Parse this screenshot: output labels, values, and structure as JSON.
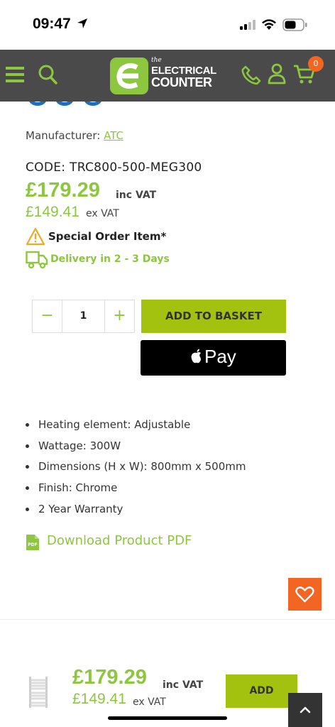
{
  "status_bar": {
    "time": "09:47"
  },
  "header": {
    "logo_the": "the",
    "logo_line1": "ELECTRICAL",
    "logo_line2": "COUNTER",
    "cart_count": "0",
    "brand_color": "#8dc63f",
    "header_bg": "#4a4a4a"
  },
  "product": {
    "manufacturer_label": "Manufacturer:",
    "manufacturer_value": "ATC",
    "code_label": "CODE:",
    "code_value": "TRC800-500-MEG300",
    "price_inc": "£179.29",
    "price_inc_label": "inc VAT",
    "price_ex": "£149.41",
    "price_ex_label": "ex VAT",
    "special_order": "Special Order Item*",
    "delivery": "Delivery in 2 - 3 Days",
    "quantity": "1",
    "quantity_minus": "−",
    "quantity_plus": "+",
    "add_to_basket": "ADD TO BASKET",
    "apple_pay": "Pay",
    "specs": [
      "Heating element: Adjustable",
      "Wattage: 300W",
      "Dimensions (H x W): 800mm x 500mm",
      "Finish: Chrome",
      "2 Year Warranty"
    ],
    "pdf_link": "Download Product PDF",
    "pdf_icon_text": "PDF"
  },
  "floating": {
    "help": "?"
  },
  "sticky_bar": {
    "price_inc": "£179.29",
    "price_inc_label": "inc VAT",
    "price_ex": "£149.41",
    "price_ex_label": "ex VAT",
    "add": "ADD"
  }
}
